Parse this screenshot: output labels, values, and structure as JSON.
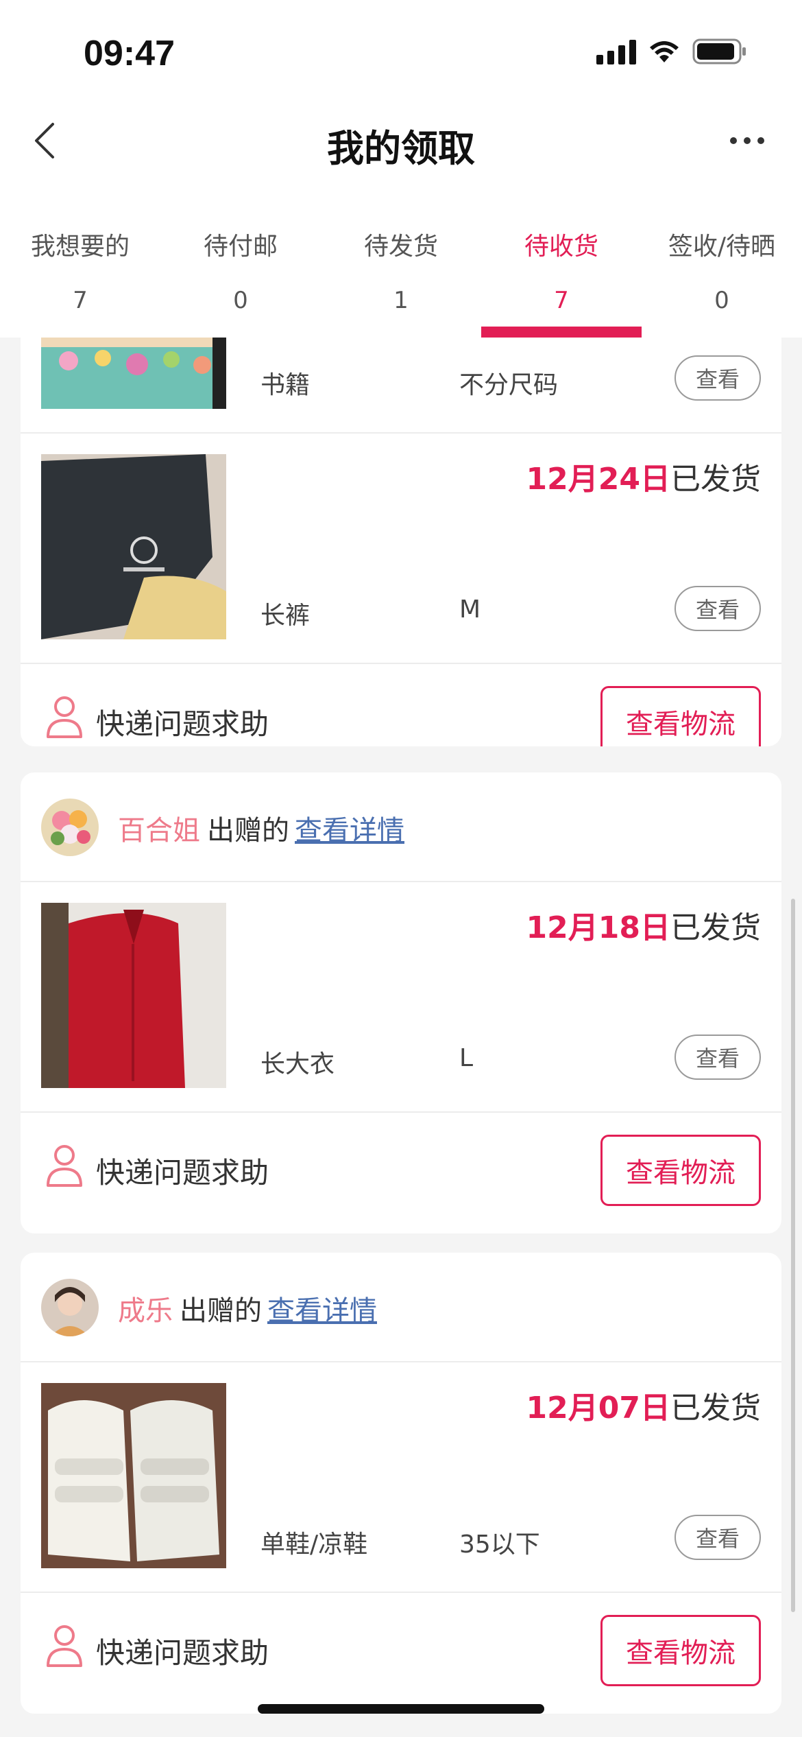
{
  "status_bar": {
    "time": "09:47"
  },
  "nav": {
    "title": "我的领取"
  },
  "tabs": [
    {
      "label": "我想要的",
      "count": "7"
    },
    {
      "label": "待付邮",
      "count": "0"
    },
    {
      "label": "待发货",
      "count": "1"
    },
    {
      "label": "待收货",
      "count": "7",
      "active": true
    },
    {
      "label": "签收/待晒",
      "count": "0"
    }
  ],
  "cards": [
    {
      "items": [
        {
          "category": "书籍",
          "size": "不分尺码",
          "view_label": "查看"
        },
        {
          "date": "12月24日",
          "status": "已发货",
          "category": "长裤",
          "size": "M",
          "view_label": "查看"
        }
      ],
      "help_text": "快递问题求助",
      "logistics_label": "查看物流"
    },
    {
      "donor": "百合姐",
      "donated_text": "出赠的",
      "details_link": "查看详情",
      "items": [
        {
          "date": "12月18日",
          "status": "已发货",
          "category": "长大衣",
          "size": "L",
          "view_label": "查看"
        }
      ],
      "help_text": "快递问题求助",
      "logistics_label": "查看物流"
    },
    {
      "donor": "成乐",
      "donated_text": "出赠的",
      "details_link": "查看详情",
      "items": [
        {
          "date": "12月07日",
          "status": "已发货",
          "category": "单鞋/凉鞋",
          "size": "35以下",
          "view_label": "查看"
        }
      ],
      "help_text": "快递问题求助",
      "logistics_label": "查看物流"
    }
  ],
  "theme": {
    "accent": "#e21e55",
    "donor_color": "#ee7a8a",
    "link_color": "#4a6fb0"
  }
}
